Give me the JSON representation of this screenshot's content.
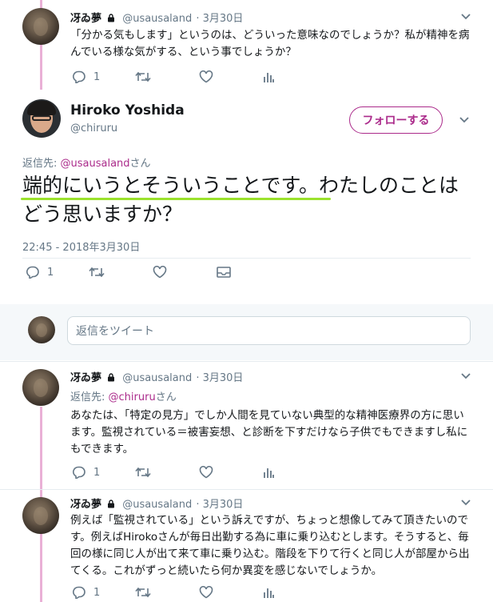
{
  "tweet1": {
    "name": "冴ゐ夢",
    "handle": "@usausaland",
    "date": "3月30日",
    "text": "「分かる気もします」というのは、どういった意味なのでしょうか？私が精神を病んでいる様な気がする、という事でしょうか？",
    "reply_count": "1"
  },
  "main": {
    "name": "Hiroko Yoshida",
    "handle": "@chiruru",
    "follow_label": "フォローする",
    "reply_prefix": "返信先: ",
    "reply_mention": "@usausaland",
    "reply_suffix": "さん",
    "text": "端的にいうとそういうことです。わたしのことはどう思いますか？",
    "timestamp": "22:45 - 2018年3月30日",
    "reply_count": "1"
  },
  "compose": {
    "placeholder": "返信をツイート"
  },
  "tweet2": {
    "name": "冴ゐ夢",
    "handle": "@usausaland",
    "date": "3月30日",
    "reply_prefix": "返信先: ",
    "reply_mention": "@chiruru",
    "reply_suffix": "さん",
    "text": "あなたは、「特定の見方」でしか人間を見ていない典型的な精神医療界の方に思います。監視されている＝被害妄想、と診断を下すだけなら子供でもできますし私にもできます。",
    "reply_count": "1"
  },
  "tweet3": {
    "name": "冴ゐ夢",
    "handle": "@usausaland",
    "date": "3月30日",
    "text": "例えば「監視されている」という訴えですが、ちょっと想像してみて頂きたいのです。例えばHirokoさんが毎日出勤する為に車に乗り込むとします。そうすると、毎回の様に同じ人が出て来て車に乗り込む。階段を下りて行くと同じ人が部屋から出てくる。これがずっと続いたら何か異変を感じないでしょうか。",
    "reply_count": "1"
  },
  "colors": {
    "accent": "#ab2b8b",
    "underline": "#9be22d",
    "thread_line": "#e9b0d6",
    "muted": "#657786"
  }
}
